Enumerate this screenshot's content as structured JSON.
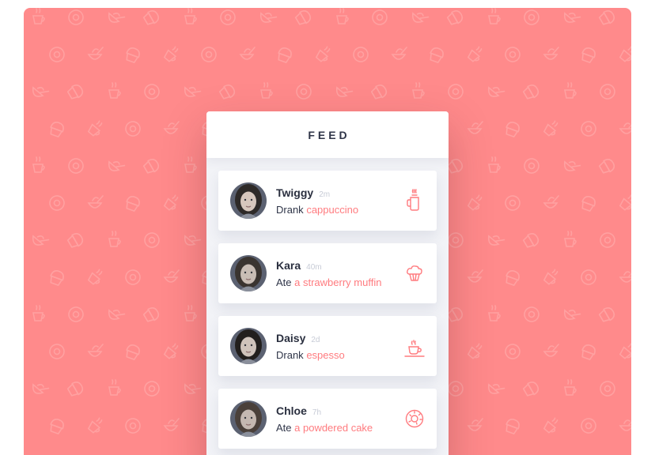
{
  "colors": {
    "background": "#ff8a8b",
    "pattern": "#ffa1a1",
    "accent": "#ff7b7f",
    "header_text": "#2f3548"
  },
  "header": {
    "title": "FEED"
  },
  "feed": [
    {
      "name": "Twiggy",
      "time": "2m",
      "verb": "Drank",
      "item": "cappuccino",
      "icon": "coffee-mug-icon"
    },
    {
      "name": "Kara",
      "time": "40m",
      "verb": "Ate",
      "item": "a strawberry muffin",
      "icon": "muffin-icon"
    },
    {
      "name": "Daisy",
      "time": "2d",
      "verb": "Drank",
      "item": "espesso",
      "icon": "coffee-cup-icon"
    },
    {
      "name": "Chloe",
      "time": "7h",
      "verb": "Ate",
      "item": "a powdered cake",
      "icon": "donut-icon"
    }
  ]
}
